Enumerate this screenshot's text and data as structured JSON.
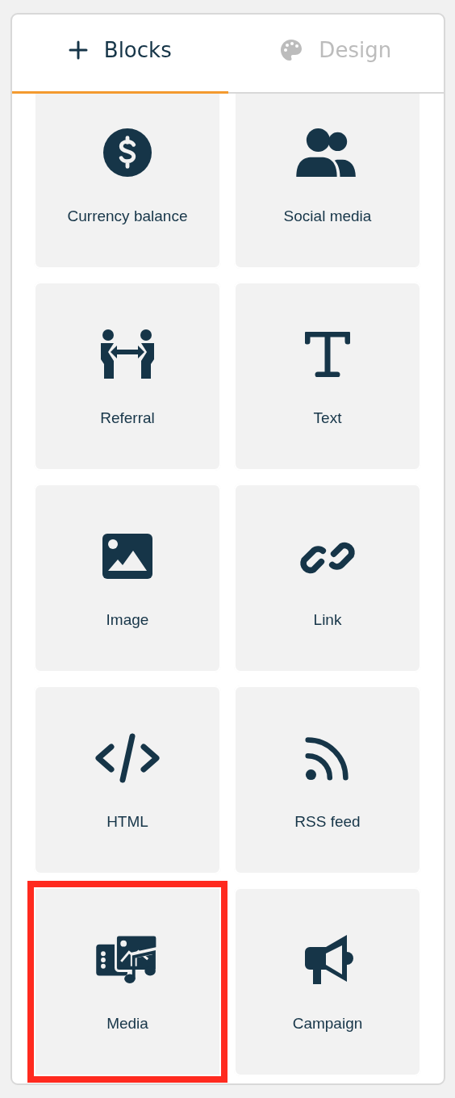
{
  "tabs": [
    {
      "label": "Blocks",
      "selected": true
    },
    {
      "label": "Design",
      "selected": false
    }
  ],
  "blocks": [
    {
      "label": "Currency balance",
      "highlighted": false
    },
    {
      "label": "Social media",
      "highlighted": false
    },
    {
      "label": "Referral",
      "highlighted": false
    },
    {
      "label": "Text",
      "highlighted": false
    },
    {
      "label": "Image",
      "highlighted": false
    },
    {
      "label": "Link",
      "highlighted": false
    },
    {
      "label": "HTML",
      "highlighted": false
    },
    {
      "label": "RSS feed",
      "highlighted": false
    },
    {
      "label": "Media",
      "highlighted": true
    },
    {
      "label": "Campaign",
      "highlighted": false
    }
  ]
}
